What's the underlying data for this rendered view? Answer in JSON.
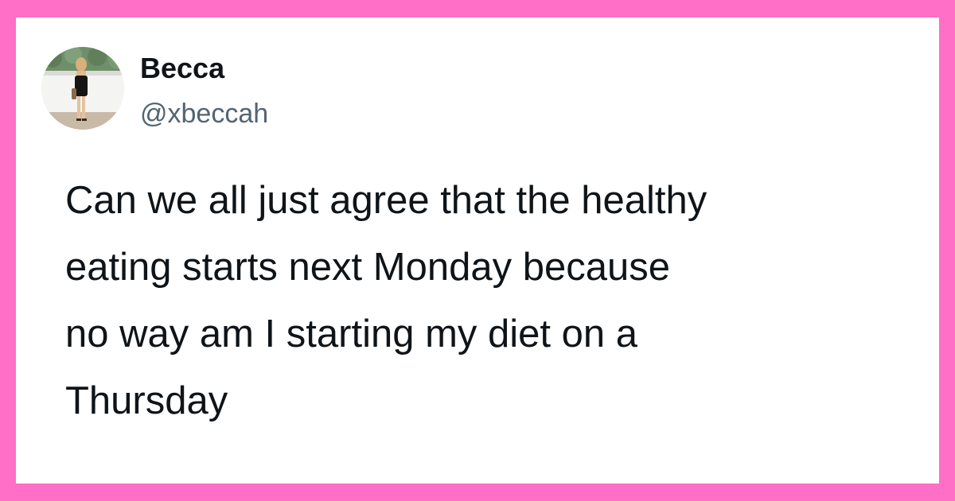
{
  "tweet": {
    "display_name": "Becca",
    "handle": "@xbeccah",
    "text_lines": [
      "Can we all just agree that the healthy",
      "eating starts next Monday because",
      "no way am I starting my diet on a",
      "Thursday"
    ]
  },
  "colors": {
    "border": "#ff6ec7",
    "background": "#ffffff",
    "name": "#0f1419",
    "handle": "#536471",
    "text": "#0f1419"
  }
}
